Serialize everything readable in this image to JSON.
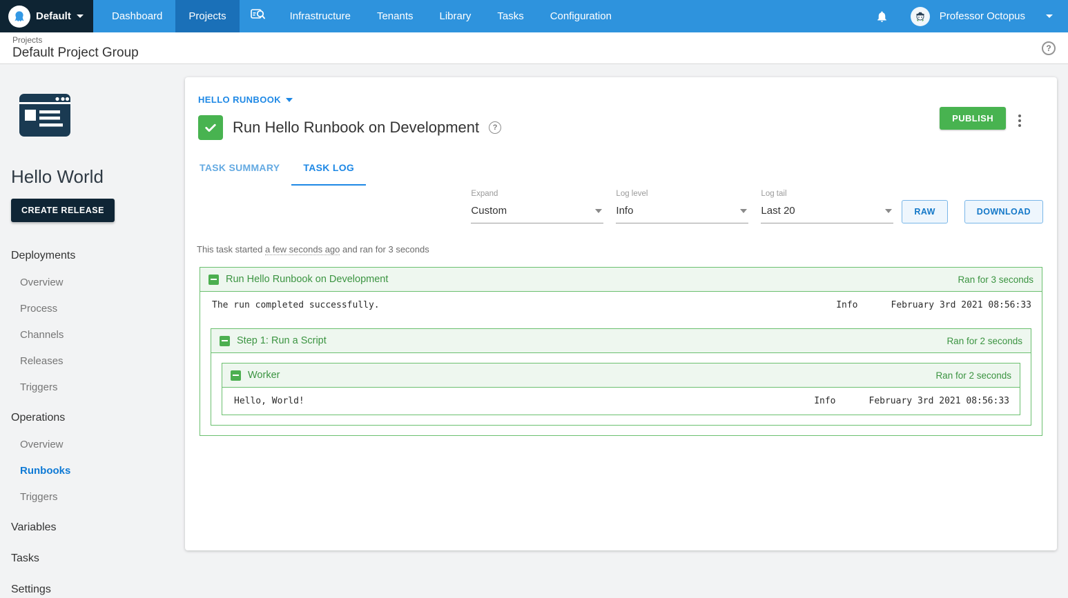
{
  "topnav": {
    "space": {
      "label": "Default"
    },
    "items": [
      {
        "label": "Dashboard"
      },
      {
        "label": "Projects"
      },
      {
        "label": "Infrastructure"
      },
      {
        "label": "Tenants"
      },
      {
        "label": "Library"
      },
      {
        "label": "Tasks"
      },
      {
        "label": "Configuration"
      }
    ],
    "user": {
      "name": "Professor Octopus"
    }
  },
  "breadcrumb": {
    "parent": "Projects",
    "title": "Default Project Group"
  },
  "sidebar": {
    "project_name": "Hello World",
    "create_release_label": "CREATE RELEASE",
    "sections": [
      {
        "label": "Deployments",
        "items": [
          {
            "label": "Overview"
          },
          {
            "label": "Process"
          },
          {
            "label": "Channels"
          },
          {
            "label": "Releases"
          },
          {
            "label": "Triggers"
          }
        ]
      },
      {
        "label": "Operations",
        "items": [
          {
            "label": "Overview"
          },
          {
            "label": "Runbooks"
          },
          {
            "label": "Triggers"
          }
        ]
      },
      {
        "label": "Variables",
        "items": []
      },
      {
        "label": "Tasks",
        "items": []
      },
      {
        "label": "Settings",
        "items": []
      }
    ]
  },
  "main": {
    "runbook_link": "HELLO RUNBOOK",
    "title": "Run Hello Runbook on Development",
    "publish_label": "PUBLISH",
    "tabs": [
      {
        "label": "TASK SUMMARY"
      },
      {
        "label": "TASK LOG"
      }
    ],
    "filters": [
      {
        "label": "Expand",
        "value": "Custom"
      },
      {
        "label": "Log level",
        "value": "Info"
      },
      {
        "label": "Log tail",
        "value": "Last 20"
      }
    ],
    "raw_label": "RAW",
    "download_label": "DOWNLOAD",
    "started": {
      "prefix": "This task started ",
      "highlight": "a few seconds ago",
      "suffix": " and ran for 3 seconds"
    }
  },
  "log": {
    "root": {
      "title": "Run Hello Runbook on Development",
      "duration": "Ran for 3 seconds",
      "line": {
        "text": "The run completed successfully.",
        "level": "Info",
        "timestamp": "February 3rd 2021 08:56:33"
      },
      "child": {
        "title": "Step 1: Run a Script",
        "duration": "Ran for 2 seconds",
        "child": {
          "title": "Worker",
          "duration": "Ran for 2 seconds",
          "line": {
            "text": "Hello, World!",
            "level": "Info",
            "timestamp": "February 3rd 2021 08:56:33"
          }
        }
      }
    }
  },
  "colors": {
    "nav_blue": "#2e93dd",
    "nav_active_blue": "#1a70b8",
    "dark_navy": "#0e2433",
    "accent_blue": "#1e88e5",
    "success_green": "#48b350",
    "log_green": "#3b9441",
    "log_green_border": "#6abf6e",
    "log_green_bg": "#eef7ef"
  }
}
